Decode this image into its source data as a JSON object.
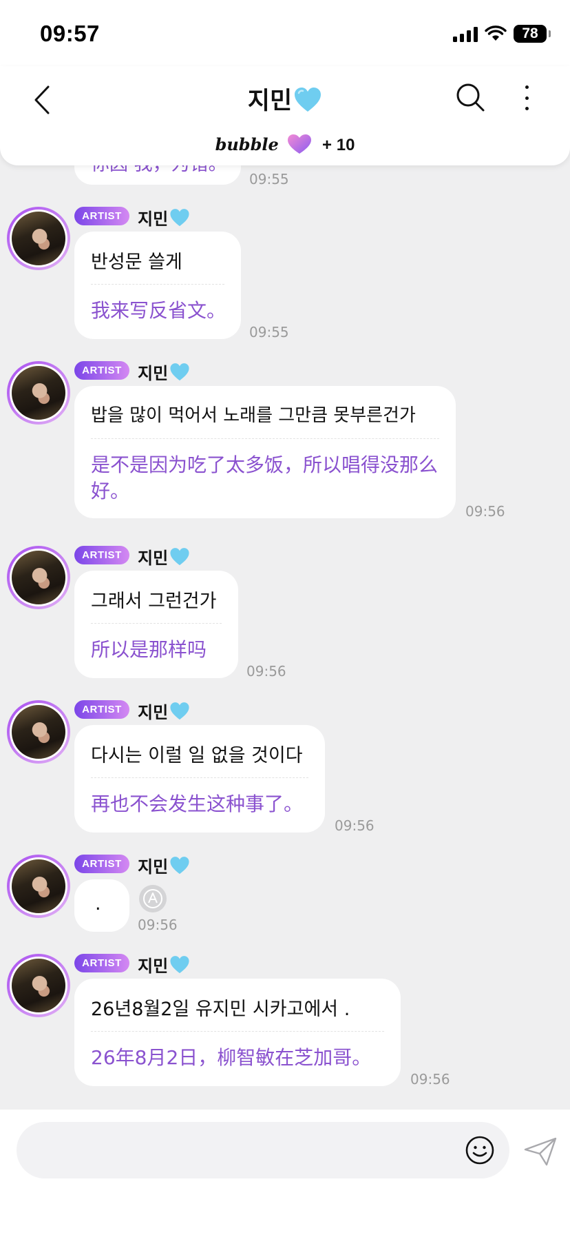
{
  "status_bar": {
    "time": "09:57",
    "battery": "78"
  },
  "header": {
    "title": "지민",
    "bubble_brand": "bubble",
    "bubble_plus": "+ 10"
  },
  "partial_message": {
    "zh": "你因 我，为错。",
    "time": "09:55"
  },
  "messages": [
    {
      "badge": "ARTIST",
      "sender": "지민",
      "ko": "반성문 쓸게",
      "zh": "我来写反省文。",
      "time": "09:55"
    },
    {
      "badge": "ARTIST",
      "sender": "지민",
      "ko": "밥을 많이 먹어서 노래를 그만큼 못부른건가",
      "zh": "是不是因为吃了太多饭，所以唱得没那么好。",
      "time": "09:56"
    },
    {
      "badge": "ARTIST",
      "sender": "지민",
      "ko": "그래서 그런건가",
      "zh": "所以是那样吗",
      "time": "09:56"
    },
    {
      "badge": "ARTIST",
      "sender": "지민",
      "ko": "다시는 이럴 일 없을 것이다",
      "zh": "再也不会发生这种事了。",
      "time": "09:56"
    },
    {
      "badge": "ARTIST",
      "sender": "지민",
      "ko": ".",
      "zh": "",
      "time": "09:56"
    },
    {
      "badge": "ARTIST",
      "sender": "지민",
      "ko": "26년8월2일 유지민 시카고에서 .",
      "zh": "26年8月2日，柳智敏在芝加哥。",
      "time": "09:56"
    }
  ],
  "colors": {
    "translation": "#8a52cf",
    "badge_start": "#7b46e8",
    "badge_end": "#d489f2",
    "background": "#efeff0"
  },
  "icons": [
    "back-arrow-icon",
    "search-icon",
    "more-vertical-icon",
    "blue-heart-icon",
    "purple-heart-icon",
    "translate-icon",
    "emoji-icon",
    "send-icon"
  ]
}
